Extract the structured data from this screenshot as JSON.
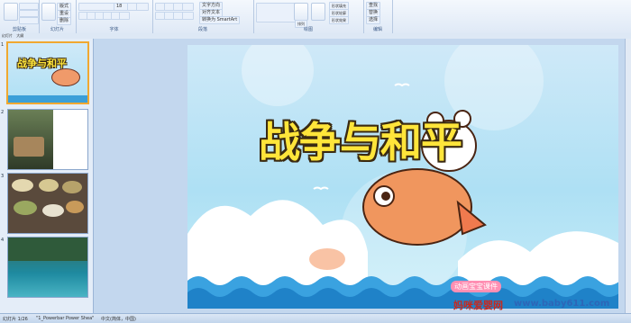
{
  "ribbon": {
    "groups": [
      {
        "label": "剪贴板"
      },
      {
        "label": "幻灯片"
      },
      {
        "label": "字体"
      },
      {
        "label": "段落"
      },
      {
        "label": "绘图"
      },
      {
        "label": "编辑"
      }
    ],
    "buttons": {
      "paste": "粘贴",
      "new_slide": "新建幻灯片",
      "layout": "版式",
      "reset": "重设",
      "delete": "删除",
      "font_size": "18",
      "text_direction": "文字方向",
      "align_text": "对齐文本",
      "smartart": "转换为 SmartArt",
      "arrange": "排列",
      "quick_styles": "快速样式",
      "shape_fill": "形状填充",
      "shape_outline": "形状轮廓",
      "shape_effects": "形状效果",
      "find": "查找",
      "replace": "替换",
      "select": "选择"
    }
  },
  "outline_tabs": [
    "幻灯片",
    "大纲"
  ],
  "slides_panel": {
    "thumbnails": [
      {
        "number": "1",
        "title": "战争与和平"
      },
      {
        "number": "2"
      },
      {
        "number": "3"
      },
      {
        "number": "4"
      }
    ]
  },
  "slide": {
    "title": "战争与和平",
    "brand_badge": "动画宝宝课件"
  },
  "watermark": {
    "cn": "妈咪爱婴网",
    "url": "www.baby611.com"
  },
  "statusbar": {
    "slide_info": "幻灯片 1/26",
    "theme": "\"1_Powerbar Power Shea\"",
    "language": "中文(简体，中国)"
  }
}
